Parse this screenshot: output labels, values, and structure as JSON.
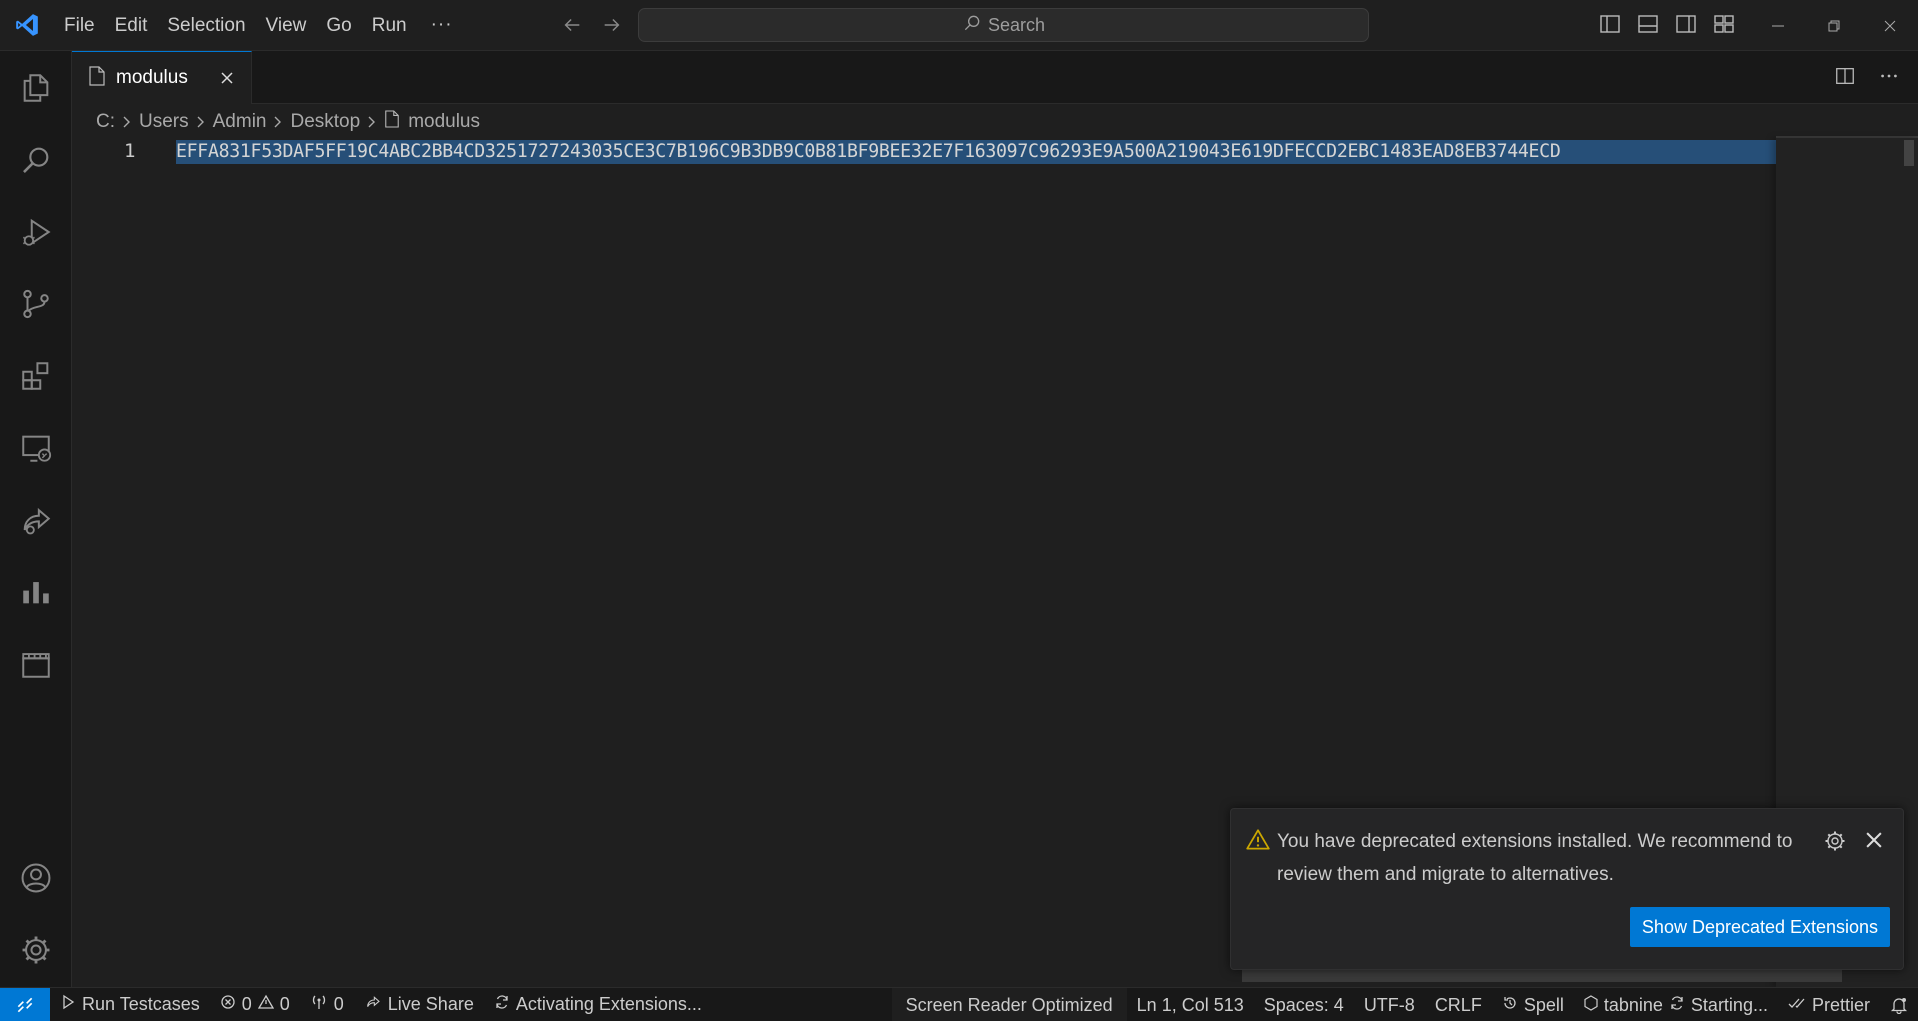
{
  "menu": {
    "items": [
      "File",
      "Edit",
      "Selection",
      "View",
      "Go",
      "Run"
    ],
    "more": "···"
  },
  "search": {
    "label": "Search"
  },
  "tab": {
    "label": "modulus"
  },
  "breadcrumb": {
    "parts": [
      "C:",
      "Users",
      "Admin",
      "Desktop"
    ],
    "file": "modulus"
  },
  "editor": {
    "line_number": "1",
    "line_text": "EFFA831F53DAF5FF19C4ABC2BB4CD3251727243035CE3C7B196C9B3DB9C0B81BF9BEE32E7F163097C96293E9A500A219043E619DFECCD2EBC1483EAD8EB3744ECD"
  },
  "notification": {
    "message": "You have deprecated extensions installed. We recommend to review them and migrate to alternatives.",
    "button": "Show Deprecated Extensions"
  },
  "statusbar": {
    "run_testcases": "Run Testcases",
    "errors": "0",
    "warnings": "0",
    "ports": "0",
    "live_share": "Live Share",
    "activating": "Activating Extensions...",
    "screen_reader": "Screen Reader Optimized",
    "position": "Ln 1, Col 513",
    "spaces": "Spaces: 4",
    "encoding": "UTF-8",
    "eol": "CRLF",
    "spell": "Spell",
    "tabnine": "tabnine",
    "starting": "Starting...",
    "prettier": "Prettier"
  },
  "colors": {
    "accent": "#0078d4",
    "selection": "#264f78",
    "warning": "#cca700",
    "background": "#1f1f1f"
  }
}
